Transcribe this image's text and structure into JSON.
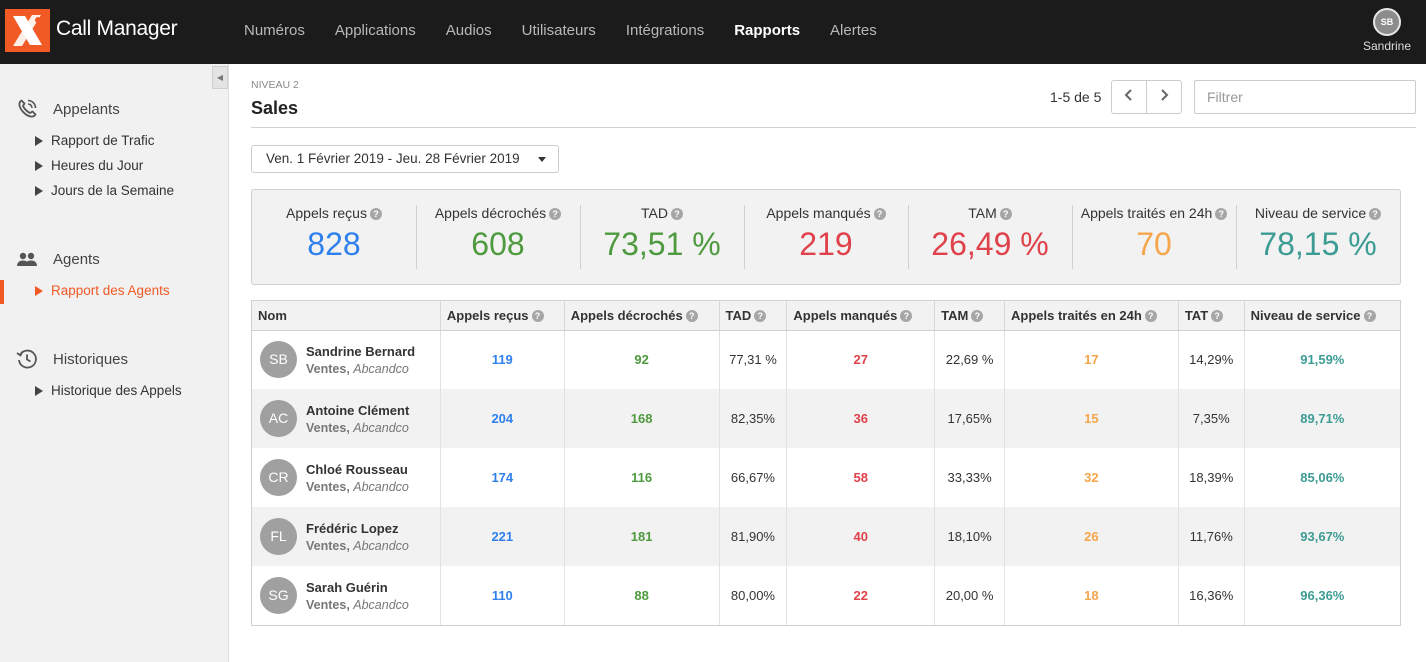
{
  "app": {
    "title": "Call Manager"
  },
  "nav": [
    {
      "label": "Numéros",
      "active": false
    },
    {
      "label": "Applications",
      "active": false
    },
    {
      "label": "Audios",
      "active": false
    },
    {
      "label": "Utilisateurs",
      "active": false
    },
    {
      "label": "Intégrations",
      "active": false
    },
    {
      "label": "Rapports",
      "active": true
    },
    {
      "label": "Alertes",
      "active": false
    }
  ],
  "user": {
    "initials": "SB",
    "name": "Sandrine"
  },
  "sidebar": {
    "sections": [
      {
        "label": "Appelants",
        "icon": "phone-icon",
        "items": [
          "Rapport de Trafic",
          "Heures du Jour",
          "Jours de la Semaine"
        ]
      },
      {
        "label": "Agents",
        "icon": "users-icon",
        "items": [
          "Rapport des Agents"
        ]
      },
      {
        "label": "Historiques",
        "icon": "history-icon",
        "items": [
          "Historique des Appels"
        ]
      }
    ],
    "active_item": "Rapport des Agents"
  },
  "page": {
    "level": "NIVEAU 2",
    "title": "Sales",
    "pagination": "1-5 de 5",
    "filter_placeholder": "Filtrer",
    "date_range": "Ven. 1 Février 2019 - Jeu. 28 Février 2019"
  },
  "colors": {
    "accent": "#f15a24",
    "blue": "#2f80ed",
    "green": "#4e9a3e",
    "red": "#e0424b",
    "orange": "#f5a54a",
    "teal": "#3c9c94"
  },
  "stats": [
    {
      "label": "Appels reçus",
      "value": "828",
      "color": "blue"
    },
    {
      "label": "Appels décrochés",
      "value": "608",
      "color": "green"
    },
    {
      "label": "TAD",
      "value": "73,51 %",
      "color": "green"
    },
    {
      "label": "Appels manqués",
      "value": "219",
      "color": "red"
    },
    {
      "label": "TAM",
      "value": "26,49 %",
      "color": "red"
    },
    {
      "label": "Appels traités en 24h",
      "value": "70",
      "color": "orange"
    },
    {
      "label": "Niveau de service",
      "value": "78,15 %",
      "color": "teal"
    }
  ],
  "table": {
    "columns": [
      "Nom",
      "Appels reçus",
      "Appels décrochés",
      "TAD",
      "Appels manqués",
      "TAM",
      "Appels traités en 24h",
      "TAT",
      "Niveau de service"
    ],
    "rows": [
      {
        "initials": "SB",
        "name": "Sandrine Bernard",
        "team": "Ventes",
        "company": "Abcandco",
        "recus": "119",
        "decroches": "92",
        "tad": "77,31 %",
        "manques": "27",
        "tam": "22,69 %",
        "traites": "17",
        "tat": "14,29%",
        "service": "91,59%"
      },
      {
        "initials": "AC",
        "name": "Antoine Clément",
        "team": "Ventes",
        "company": "Abcandco",
        "recus": "204",
        "decroches": "168",
        "tad": "82,35%",
        "manques": "36",
        "tam": "17,65%",
        "traites": "15",
        "tat": "7,35%",
        "service": "89,71%"
      },
      {
        "initials": "CR",
        "name": "Chloé Rousseau",
        "team": "Ventes",
        "company": "Abcandco",
        "recus": "174",
        "decroches": "116",
        "tad": "66,67%",
        "manques": "58",
        "tam": "33,33%",
        "traites": "32",
        "tat": "18,39%",
        "service": "85,06%"
      },
      {
        "initials": "FL",
        "name": "Frédéric Lopez",
        "team": "Ventes",
        "company": "Abcandco",
        "recus": "221",
        "decroches": "181",
        "tad": "81,90%",
        "manques": "40",
        "tam": "18,10%",
        "traites": "26",
        "tat": "11,76%",
        "service": "93,67%"
      },
      {
        "initials": "SG",
        "name": "Sarah Guérin",
        "team": "Ventes",
        "company": "Abcandco",
        "recus": "110",
        "decroches": "88",
        "tad": "80,00%",
        "manques": "22",
        "tam": "20,00 %",
        "traites": "18",
        "tat": "16,36%",
        "service": "96,36%"
      }
    ]
  }
}
